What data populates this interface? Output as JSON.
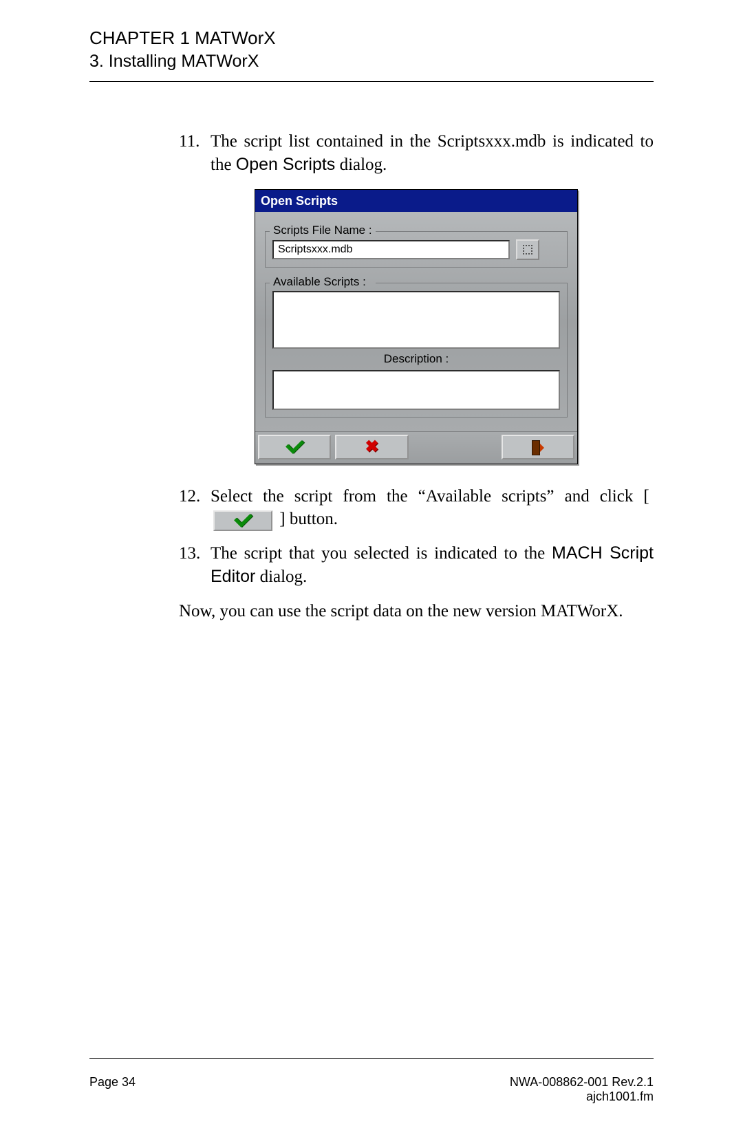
{
  "header": {
    "chapter": "CHAPTER 1 MATWorX",
    "section": "3. Installing MATWorX"
  },
  "steps": {
    "s11": {
      "num": "11.",
      "before": "The script list contained in the Scriptsxxx.mdb is indicated to the ",
      "bold": "Open Scripts",
      "after": " dialog."
    },
    "s12": {
      "num": "12.",
      "before": "Select the script from the “Available scripts” and click [ ",
      "after": " ] button."
    },
    "s13": {
      "num": "13.",
      "before": "The script that you selected is indicated to the ",
      "bold": "MACH Script Editor",
      "after": " dialog."
    }
  },
  "closing": "Now, you can use the script data on the new version MATWorX.",
  "dialog": {
    "title": "Open Scripts",
    "file_label": "Scripts File Name :",
    "file_value": "Scriptsxxx.mdb",
    "avail_label": "Available Scripts :",
    "desc_label": "Description :"
  },
  "footer": {
    "page": "Page 34",
    "doc": "NWA-008862-001 Rev.2.1",
    "file": "ajch1001.fm"
  }
}
